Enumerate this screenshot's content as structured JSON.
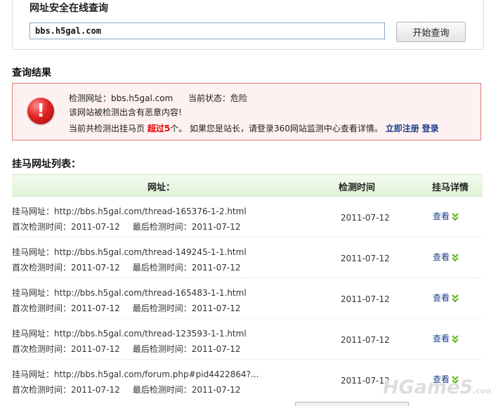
{
  "search": {
    "title": "网址安全在线查询",
    "input_value": "bbs.h5gal.com",
    "button_label": "开始查询"
  },
  "result": {
    "title": "查询结果",
    "url_label": "检测网址：",
    "url_value": "bbs.h5gal.com",
    "status_label": "当前状态：",
    "status_value": "危险",
    "warning_text": "该网站被检测出含有恶意内容!",
    "count_prefix": "当前共检测出挂马页",
    "count_value": "超过5",
    "count_suffix": "个。  如果您是站长，请登录360网站监测中心查看详情。",
    "register_link": "立即注册",
    "login_link": "登录",
    "icon": "exclamation-icon",
    "icon_glyph": "!"
  },
  "list": {
    "title": "挂马网址列表：",
    "headers": {
      "url": "网址：",
      "time": "检测时间",
      "detail": "挂马详情"
    },
    "url_prefix": "挂马网址：",
    "first_label": "首次检测时间：",
    "last_label": "最后检测时间：",
    "view_label": "查看",
    "rows": [
      {
        "url": "http://bbs.h5gal.com/thread-165376-1-2.html",
        "first": "2011-07-12",
        "last": "2011-07-12",
        "time": "2011-07-12"
      },
      {
        "url": "http://bbs.h5gal.com/thread-149245-1-1.html",
        "first": "2011-07-12",
        "last": "2011-07-12",
        "time": "2011-07-12"
      },
      {
        "url": "http://bbs.h5gal.com/thread-165483-1-1.html",
        "first": "2011-07-12",
        "last": "2011-07-12",
        "time": "2011-07-12"
      },
      {
        "url": "http://bbs.h5gal.com/thread-123593-1-1.html",
        "first": "2011-07-12",
        "last": "2011-07-12",
        "time": "2011-07-12"
      },
      {
        "url": "http://bbs.h5gal.com/forum.php#pid4422864?...",
        "first": "2011-07-12",
        "last": "2011-07-12",
        "time": "2011-07-12"
      }
    ]
  },
  "watermark": {
    "main": "HGame5",
    "suffix": ".com"
  },
  "colors": {
    "accent_red": "#e60000",
    "link_blue": "#1a3f8a",
    "header_green": "#dff2d6",
    "alert_border": "#e07b7b"
  }
}
